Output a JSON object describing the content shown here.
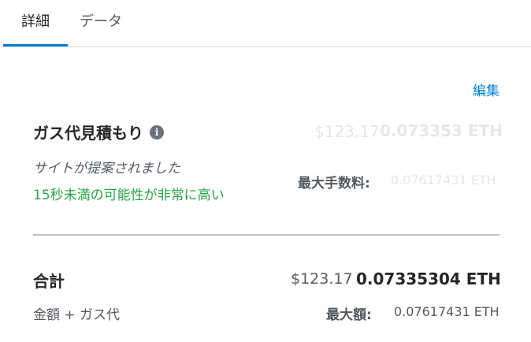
{
  "tabs": [
    {
      "label": "詳細",
      "active": true
    },
    {
      "label": "データ",
      "active": false
    }
  ],
  "colors": {
    "accent": "#037dd6",
    "success": "#28a745",
    "muted": "#e5e7ea"
  },
  "details": {
    "edit_label": "編集",
    "gas": {
      "title": "ガス代見積もり",
      "info_icon": "i",
      "fiat": "$123.17",
      "eth": "0.073353 ETH",
      "suggested": "サイトが提案されました",
      "likely": "15秒未満の可能性が非常に高い",
      "max_fee_label": "最大手数料:",
      "max_fee_value": "0.07617431 ETH"
    },
    "total": {
      "title": "合計",
      "fiat": "$123.17",
      "eth": "0.07335304 ETH",
      "subtitle": "金額 + ガス代",
      "max_amount_label": "最大額:",
      "max_amount_value": "0.07617431 ETH"
    }
  }
}
